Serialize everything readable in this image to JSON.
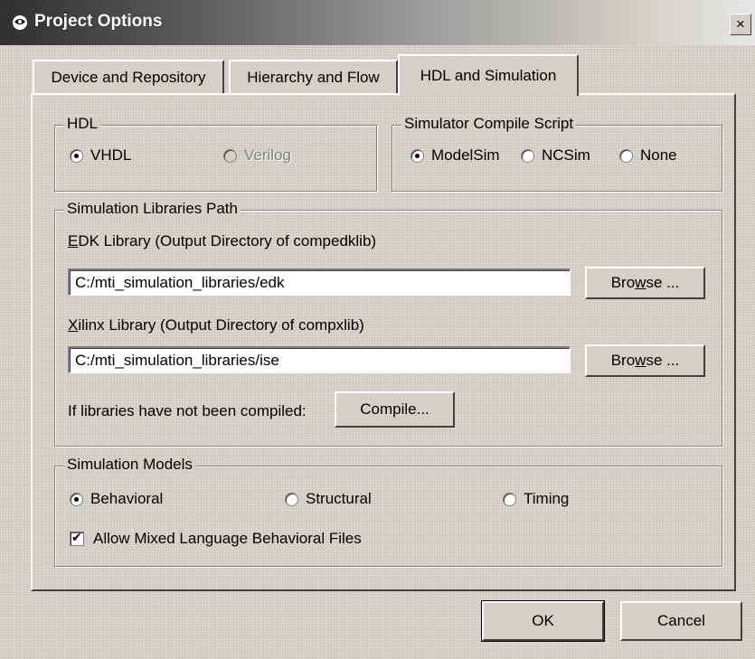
{
  "window": {
    "title": "Project Options",
    "close_label": "×"
  },
  "tabs": [
    {
      "label": "Device and Repository",
      "active": false
    },
    {
      "label": "Hierarchy and Flow",
      "active": false
    },
    {
      "label": "HDL and Simulation",
      "active": true
    }
  ],
  "hdl": {
    "legend": "HDL",
    "options": [
      {
        "label": "VHDL",
        "selected": true,
        "enabled": true
      },
      {
        "label": "Verilog",
        "selected": false,
        "enabled": false
      }
    ]
  },
  "compile_script": {
    "legend": "Simulator Compile Script",
    "options": [
      {
        "label": "ModelSim",
        "selected": true
      },
      {
        "label": "NCSim",
        "selected": false
      },
      {
        "label": "None",
        "selected": false
      }
    ]
  },
  "sim_lib_path": {
    "legend": "Simulation Libraries Path",
    "edk_label_first": "E",
    "edk_label_rest": "DK Library (Output Directory of compedklib)",
    "edk_value": "C:/mti_simulation_libraries/edk",
    "xilinx_label_first": "X",
    "xilinx_label_rest": "ilinx Library (Output Directory of compxlib)",
    "xilinx_value": "C:/mti_simulation_libraries/ise",
    "browse_pre": "Bro",
    "browse_u": "w",
    "browse_post": "se ...",
    "compile_prompt": "If libraries have not been compiled:",
    "compile_button": "Compile..."
  },
  "sim_models": {
    "legend": "Simulation Models",
    "options": [
      {
        "label": "Behavioral",
        "selected": true
      },
      {
        "label": "Structural",
        "selected": false
      },
      {
        "label": "Timing",
        "selected": false
      }
    ],
    "mixed_lang_label": "Allow Mixed Language Behavioral Files",
    "mixed_lang_checked": true
  },
  "footer": {
    "ok_label": "OK",
    "cancel_label": "Cancel"
  }
}
